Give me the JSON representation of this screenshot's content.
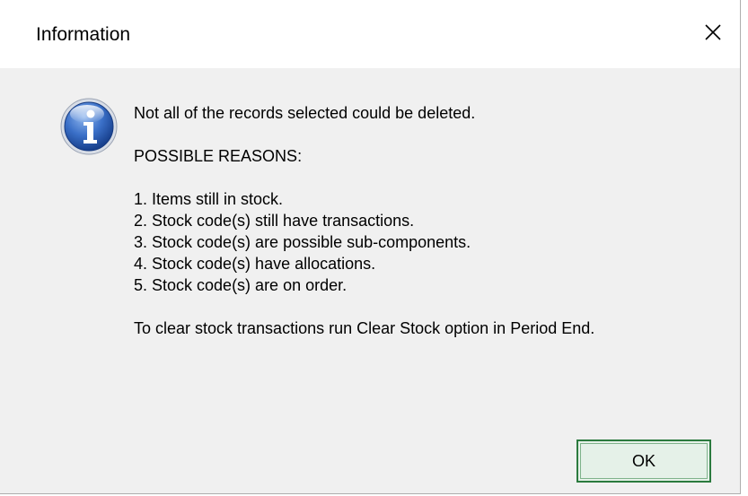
{
  "window": {
    "title": "Information",
    "close_icon": "close-icon"
  },
  "message": {
    "headline": "Not all of the records selected could be deleted.",
    "reasons_heading": "POSSIBLE REASONS:",
    "reasons": [
      "1. Items still in stock.",
      "2. Stock code(s) still have transactions.",
      "3. Stock code(s) are possible sub-components.",
      "4. Stock code(s) have allocations.",
      "5. Stock code(s) are on order."
    ],
    "footer": "To clear stock transactions run Clear Stock option in Period End."
  },
  "icon": "info-icon",
  "buttons": {
    "ok_label": "OK"
  },
  "colors": {
    "accent_border": "#2b7a3e",
    "button_fill": "#e5f1e8",
    "icon_blue": "#1e4fa3"
  }
}
